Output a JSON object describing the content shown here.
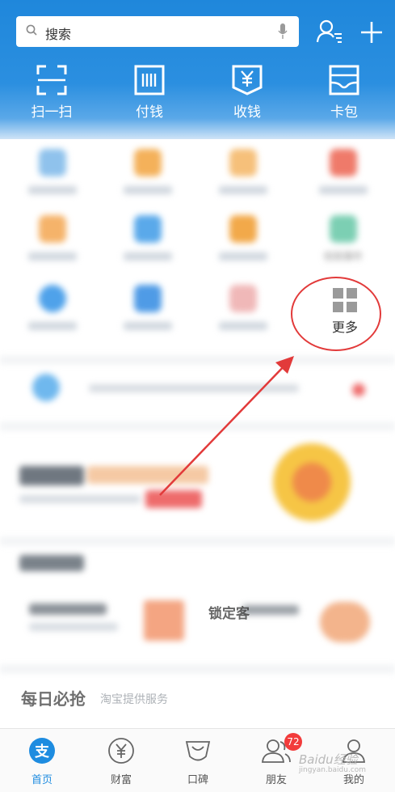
{
  "header": {
    "search": {
      "placeholder": "搜索"
    },
    "quick_actions": [
      {
        "label": "扫一扫",
        "icon": "scan-icon"
      },
      {
        "label": "付钱",
        "icon": "barcode-icon"
      },
      {
        "label": "收钱",
        "icon": "yen-box-icon"
      },
      {
        "label": "卡包",
        "icon": "card-wallet-icon"
      }
    ]
  },
  "grid": {
    "row2_label_4": "校政事件",
    "more_label": "更多"
  },
  "sections": {
    "recommend_title": "锁定客",
    "daily_title": "每日必抢",
    "daily_sub": "淘宝提供服务"
  },
  "tabbar": {
    "items": [
      {
        "label": "首页",
        "icon": "alipay-home-icon",
        "active": true
      },
      {
        "label": "财富",
        "icon": "yen-circle-icon"
      },
      {
        "label": "口碑",
        "icon": "koubei-icon"
      },
      {
        "label": "朋友",
        "icon": "friends-icon"
      },
      {
        "label": "我的",
        "icon": "profile-icon"
      }
    ],
    "friends_badge": "72"
  },
  "watermark": {
    "main": "Baidu经验",
    "sub": "jingyan.baidu.com"
  },
  "colors": {
    "brand_blue": "#1f87db",
    "annotation_red": "#e23a3a",
    "badge_red": "#f23b3b"
  }
}
